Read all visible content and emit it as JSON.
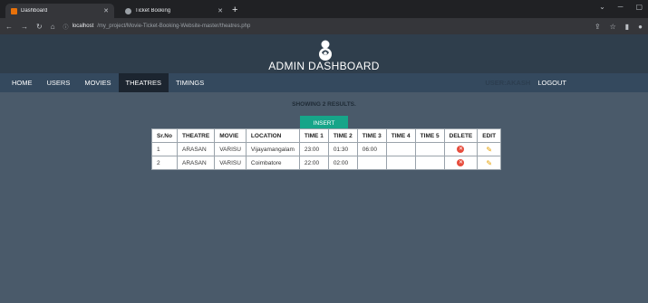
{
  "browser": {
    "tabs": [
      {
        "label": "Dashboard",
        "icon_color": "#e8710a"
      },
      {
        "label": "Ticket Booking",
        "icon_color": "#9aa0a6"
      }
    ],
    "new_tab": "+",
    "url_host": "localhost",
    "url_path": "/my_project/Movie-Ticket-Booking-Website-master/theatres.php"
  },
  "header": {
    "title": "ADMIN DASHBOARD"
  },
  "nav": {
    "items": [
      "HOME",
      "USERS",
      "MOVIES",
      "THEATRES",
      "TIMINGS"
    ],
    "active": "THEATRES",
    "user": "USER:AKASH",
    "logout": "LOGOUT"
  },
  "results_text": "SHOWING 2 RESULTS.",
  "insert_label": "INSERT",
  "table": {
    "headers": [
      "Sr.No",
      "THEATRE",
      "MOVIE",
      "LOCATION",
      "TIME 1",
      "TIME 2",
      "TIME 3",
      "TIME 4",
      "TIME 5",
      "DELETE",
      "EDIT"
    ],
    "rows": [
      [
        "1",
        "ARASAN",
        "VARISU",
        "Vijayamangalam",
        "23:00",
        "01:30",
        "06:00",
        "",
        ""
      ],
      [
        "2",
        "ARASAN",
        "VARISU",
        "Coimbatore",
        "22:00",
        "02:00",
        "",
        "",
        ""
      ]
    ]
  },
  "colors": {
    "page_bg": "#4a5a6a",
    "header_bg": "#2f3e4c",
    "nav_bg": "#34495e",
    "insert_bg": "#17a589",
    "delete": "#e74c3c",
    "edit": "#e6a000"
  }
}
